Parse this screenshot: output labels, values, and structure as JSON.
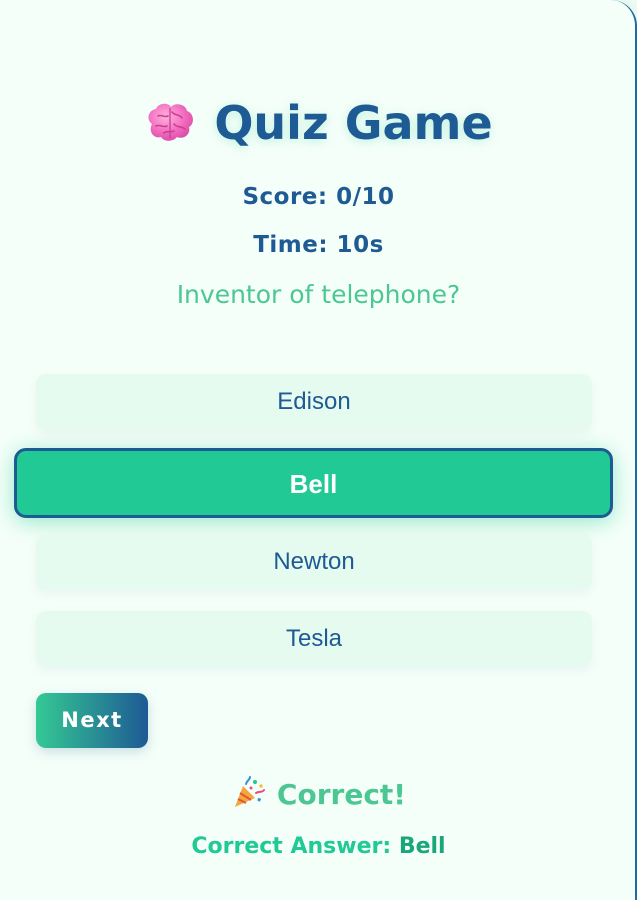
{
  "app": {
    "title": "Quiz Game",
    "title_icon": "brain-icon"
  },
  "status": {
    "score": "Score: 0/10",
    "time": "Time: 10s"
  },
  "question": "Inventor of telephone?",
  "options": [
    {
      "label": "Edison",
      "selected": false
    },
    {
      "label": "Bell",
      "selected": true
    },
    {
      "label": "Newton",
      "selected": false
    },
    {
      "label": "Tesla",
      "selected": false
    }
  ],
  "next_button": {
    "label": "Next"
  },
  "feedback": {
    "icon": "party-popper-icon",
    "text": "Correct!",
    "answer_label": "Correct Answer:",
    "answer_value": "Bell"
  },
  "colors": {
    "primary": "#1e5a94",
    "accent": "#21c994",
    "accent_light": "#4cc794",
    "option_bg": "#e6fbef",
    "background": "#f5fff9"
  }
}
